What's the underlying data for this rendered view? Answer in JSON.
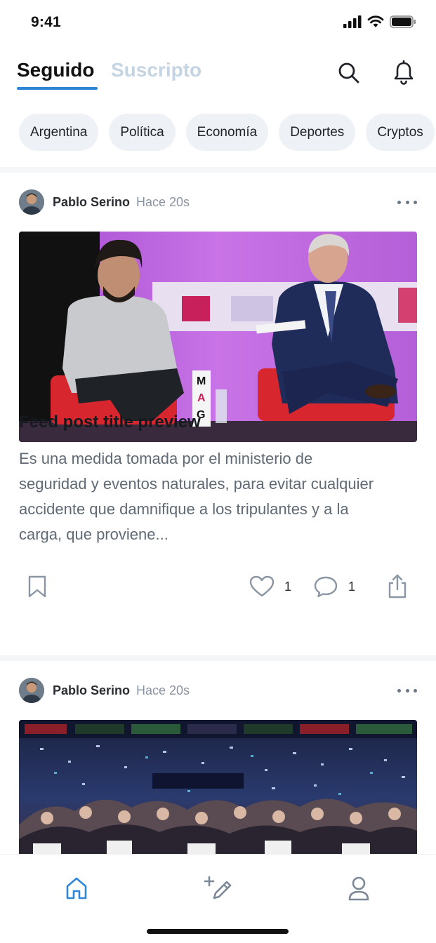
{
  "status_bar": {
    "time": "9:41"
  },
  "header": {
    "tabs": [
      {
        "label": "Seguido",
        "active": true
      },
      {
        "label": "Suscripto",
        "active": false
      }
    ],
    "icons": [
      "search-icon",
      "bell-icon"
    ]
  },
  "chips": [
    "Argentina",
    "Política",
    "Economía",
    "Deportes",
    "Cryptos"
  ],
  "posts": [
    {
      "author": "Pablo Serino",
      "time": "Hace 20s",
      "title": "Feed post title preview",
      "body": "Es una medida tomada por el ministerio de seguridad y eventos naturales, para evitar cualquier accidente que damnifique a los tripulantes y a la carga, que proviene...",
      "likes": "1",
      "comments": "1"
    },
    {
      "author": "Pablo Serino",
      "time": "Hace 20s"
    }
  ],
  "bottom_nav": [
    "home-icon",
    "compose-icon",
    "profile-icon"
  ],
  "colors": {
    "accent": "#2f86d6",
    "inactive_tab": "#c5d4e2",
    "chip_bg": "#eef2f6"
  }
}
